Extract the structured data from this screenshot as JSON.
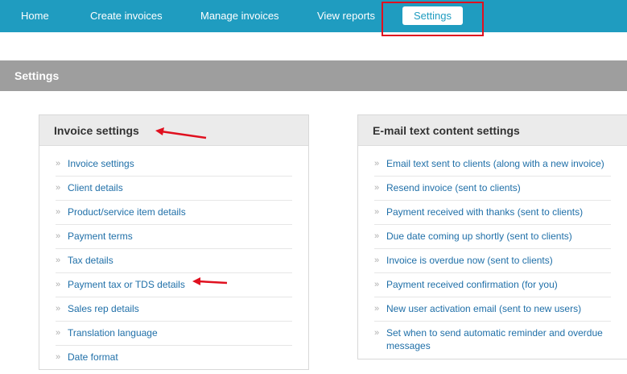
{
  "nav": {
    "items": [
      {
        "label": "Home"
      },
      {
        "label": "Create invoices"
      },
      {
        "label": "Manage invoices"
      },
      {
        "label": "View reports"
      },
      {
        "label": "Settings"
      }
    ]
  },
  "section": {
    "title": "Settings"
  },
  "invoice_panel": {
    "title": "Invoice settings",
    "items": [
      "Invoice settings",
      "Client details",
      "Product/service item details",
      "Payment terms",
      "Tax details",
      "Payment tax or TDS details",
      "Sales rep details",
      "Translation language",
      "Date format"
    ]
  },
  "email_panel": {
    "title": "E-mail text content settings",
    "items": [
      "Email text sent to clients (along with a new invoice)",
      "Resend invoice (sent to clients)",
      "Payment received with thanks (sent to clients)",
      "Due date coming up shortly (sent to clients)",
      "Invoice is overdue now (sent to clients)",
      "Payment received confirmation (for you)",
      "New user activation email (sent to new users)",
      "Set when to send automatic reminder and overdue messages"
    ]
  },
  "colors": {
    "nav_bg": "#1f9cc0",
    "section_bg": "#9e9e9e",
    "link": "#1f6fa8",
    "annotation_red": "#e0101f"
  }
}
